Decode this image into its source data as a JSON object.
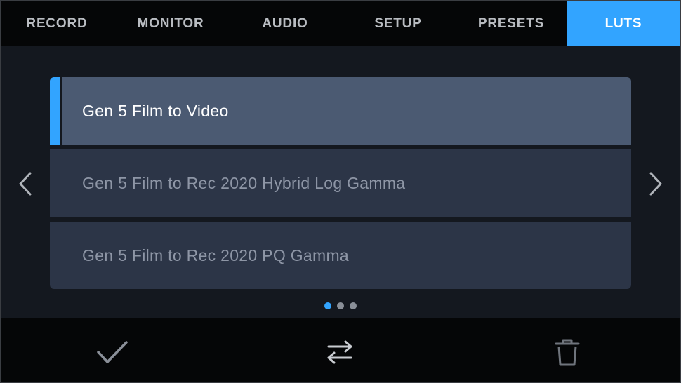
{
  "tabs": [
    {
      "label": "RECORD",
      "active": false
    },
    {
      "label": "MONITOR",
      "active": false
    },
    {
      "label": "AUDIO",
      "active": false
    },
    {
      "label": "SETUP",
      "active": false
    },
    {
      "label": "PRESETS",
      "active": false
    },
    {
      "label": "LUTS",
      "active": true
    }
  ],
  "luts": {
    "items": [
      {
        "label": "Gen 5 Film to Video",
        "selected": true
      },
      {
        "label": "Gen 5 Film to Rec 2020 Hybrid Log Gamma",
        "selected": false
      },
      {
        "label": "Gen 5 Film to Rec 2020 PQ Gamma",
        "selected": false
      }
    ]
  },
  "pager": {
    "pages": 3,
    "current": 1
  },
  "toolbar": {
    "icons": [
      "checkmark-icon",
      "swap-arrows-icon",
      "trash-icon"
    ]
  },
  "colors": {
    "accent": "#32a4ff",
    "selected_row": "#4b5a72",
    "row": "#2c3547",
    "background": "#14181f",
    "bar": "#050607"
  }
}
